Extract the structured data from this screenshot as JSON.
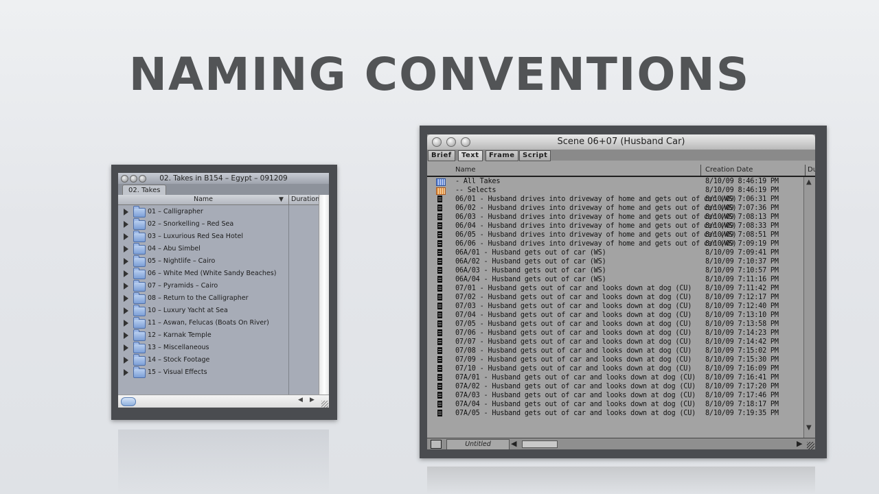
{
  "slide": {
    "title": "NAMING CONVENTIONS"
  },
  "left_window": {
    "title": "02. Takes in B154 – Egypt – 091209",
    "tab": "02. Takes",
    "columns": {
      "name": "Name",
      "duration": "Duration"
    },
    "items": [
      "01 – Calligrapher",
      "02 – Snorkelling – Red Sea",
      "03 – Luxurious Red Sea Hotel",
      "04 – Abu Simbel",
      "05 – Nightlife – Cairo",
      "06 – White Med (White Sandy Beaches)",
      "07 – Pyramids – Cairo",
      "08 – Return to the Calligrapher",
      "10 – Luxury Yacht at Sea",
      "11 – Aswan, Felucas (Boats On River)",
      "12 – Karnak Temple",
      "13 – Miscellaneous",
      "14 – Stock Footage",
      "15 – Visual Effects"
    ]
  },
  "right_window": {
    "title": "Scene 06+07 (Husband Car)",
    "tabs": [
      "Brief",
      "Text",
      "Frame",
      "Script"
    ],
    "active_tab": "Text",
    "columns": {
      "name": "Name",
      "creation_date": "Creation Date",
      "duration_partial": "Du"
    },
    "status_label": "Untitled",
    "rows": [
      {
        "icon": "bin-icon",
        "name": "- All Takes",
        "date": "8/10/09 8:46:19 PM"
      },
      {
        "icon": "selects-bin-icon",
        "name": "-- Selects",
        "date": "8/10/09 8:46:19 PM"
      },
      {
        "icon": "clip-icon",
        "name": "06/01 - Husband drives into driveway of home and gets out of car (WS)",
        "date": "8/10/09 7:06:31 PM"
      },
      {
        "icon": "clip-icon",
        "name": "06/02 - Husband drives into driveway of home and gets out of car (WS)",
        "date": "8/10/09 7:07:36 PM"
      },
      {
        "icon": "clip-icon",
        "name": "06/03 - Husband drives into driveway of home and gets out of car (WS)",
        "date": "8/10/09 7:08:13 PM"
      },
      {
        "icon": "clip-icon",
        "name": "06/04 - Husband drives into driveway of home and gets out of car (WS)",
        "date": "8/10/09 7:08:33 PM"
      },
      {
        "icon": "clip-icon",
        "name": "06/05 - Husband drives into driveway of home and gets out of car (WS)",
        "date": "8/10/09 7:08:51 PM"
      },
      {
        "icon": "clip-icon",
        "name": "06/06 - Husband drives into driveway of home and gets out of car (WS)",
        "date": "8/10/09 7:09:19 PM"
      },
      {
        "icon": "clip-icon",
        "name": "06A/01 - Husband gets out of car (WS)",
        "date": "8/10/09 7:09:41 PM"
      },
      {
        "icon": "clip-icon",
        "name": "06A/02 - Husband gets out of car (WS)",
        "date": "8/10/09 7:10:37 PM"
      },
      {
        "icon": "clip-icon",
        "name": "06A/03 - Husband gets out of car (WS)",
        "date": "8/10/09 7:10:57 PM"
      },
      {
        "icon": "clip-icon",
        "name": "06A/04 - Husband gets out of car (WS)",
        "date": "8/10/09 7:11:16 PM"
      },
      {
        "icon": "clip-icon",
        "name": "07/01 - Husband gets out of car and looks down at dog (CU)",
        "date": "8/10/09 7:11:42 PM"
      },
      {
        "icon": "clip-icon",
        "name": "07/02 - Husband gets out of car and looks down at dog (CU)",
        "date": "8/10/09 7:12:17 PM"
      },
      {
        "icon": "clip-icon",
        "name": "07/03 - Husband gets out of car and looks down at dog (CU)",
        "date": "8/10/09 7:12:40 PM"
      },
      {
        "icon": "clip-icon",
        "name": "07/04 - Husband gets out of car and looks down at dog (CU)",
        "date": "8/10/09 7:13:10 PM"
      },
      {
        "icon": "clip-icon",
        "name": "07/05 - Husband gets out of car and looks down at dog (CU)",
        "date": "8/10/09 7:13:58 PM"
      },
      {
        "icon": "clip-icon",
        "name": "07/06 - Husband gets out of car and looks down at dog (CU)",
        "date": "8/10/09 7:14:23 PM"
      },
      {
        "icon": "clip-icon",
        "name": "07/07 - Husband gets out of car and looks down at dog (CU)",
        "date": "8/10/09 7:14:42 PM"
      },
      {
        "icon": "clip-icon",
        "name": "07/08 - Husband gets out of car and looks down at dog (CU)",
        "date": "8/10/09 7:15:02 PM"
      },
      {
        "icon": "clip-icon",
        "name": "07/09 - Husband gets out of car and looks down at dog (CU)",
        "date": "8/10/09 7:15:30 PM"
      },
      {
        "icon": "clip-icon",
        "name": "07/10 - Husband gets out of car and looks down at dog (CU)",
        "date": "8/10/09 7:16:09 PM"
      },
      {
        "icon": "clip-icon",
        "name": "07A/01 - Husband gets out of car and looks down at dog (CU)",
        "date": "8/10/09 7:16:41 PM"
      },
      {
        "icon": "clip-icon",
        "name": "07A/02 - Husband gets out of car and looks down at dog (CU)",
        "date": "8/10/09 7:17:20 PM"
      },
      {
        "icon": "clip-icon",
        "name": "07A/03 - Husband gets out of car and looks down at dog (CU)",
        "date": "8/10/09 7:17:46 PM"
      },
      {
        "icon": "clip-icon",
        "name": "07A/04 - Husband gets out of car and looks down at dog (CU)",
        "date": "8/10/09 7:18:17 PM"
      },
      {
        "icon": "clip-icon",
        "name": "07A/05 - Husband gets out of car and looks down at dog (CU)",
        "date": "8/10/09 7:19:35 PM"
      }
    ]
  }
}
